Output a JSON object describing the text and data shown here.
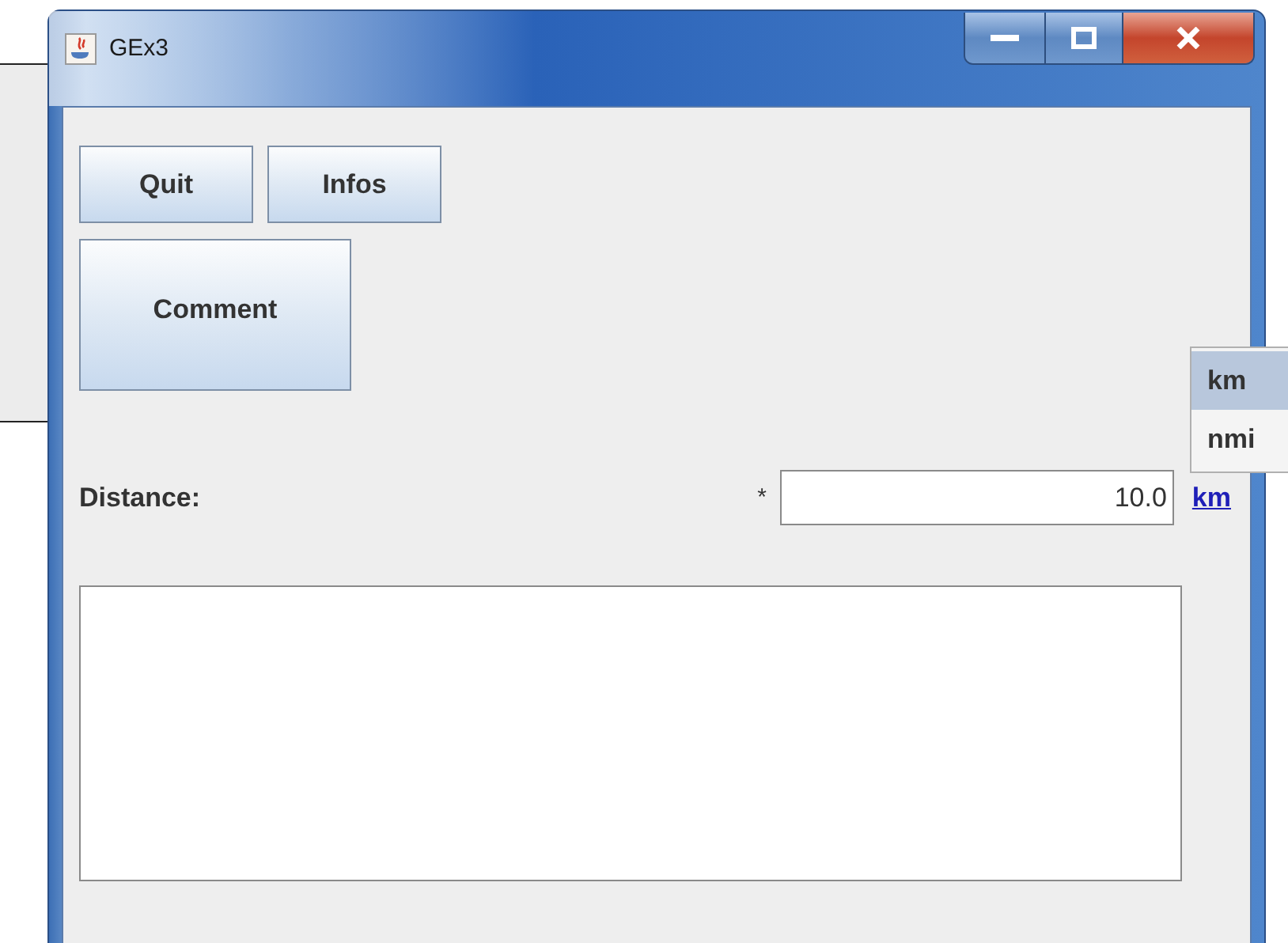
{
  "window": {
    "title": "GEx3"
  },
  "button_rows": [
    [
      "Quit",
      "Infos"
    ],
    [
      "Comment"
    ]
  ],
  "distance": {
    "label": "Distance:",
    "required_mark": "*",
    "value": "10.0",
    "unit_link": "km"
  },
  "unit_menu": {
    "items": [
      {
        "label": "km",
        "selected": true
      },
      {
        "label": "nmi",
        "selected": false
      }
    ]
  }
}
